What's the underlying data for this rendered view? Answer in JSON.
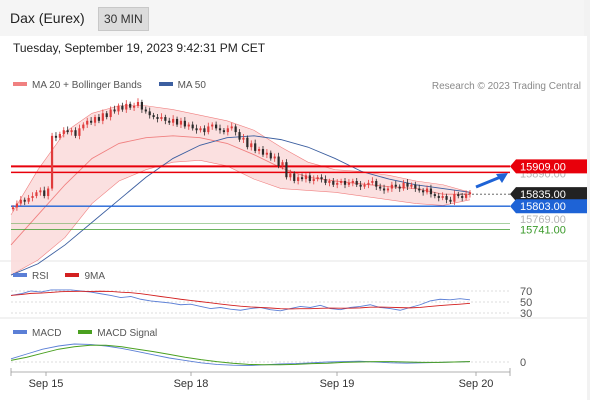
{
  "header": {
    "title": "Dax (Eurex)",
    "interval": "30 MIN"
  },
  "timestamp": "Tuesday, September 19, 2023 9:42:31 PM CET",
  "legend": {
    "bollinger": "MA 20 + Bollinger Bands",
    "ma50": "MA 50",
    "copyright": "Research © 2023 Trading Central"
  },
  "colors": {
    "bollinger": "#f08080",
    "band_fill": "#fadbdb",
    "ma50": "#3c5fa0",
    "resistance": "#e8000b",
    "pivot": "#1e63d6",
    "support": "#3a9a2a",
    "rsi": "#5b7fd6",
    "rsi_ma": "#d32020",
    "macd": "#5b7fd6",
    "macd_signal": "#4aa020",
    "up_candle": "#e03b3b",
    "down_candle": "#2a2a2a"
  },
  "chart_data": {
    "type": "candlestick",
    "instrument": "Dax (Eurex)",
    "interval": "30 MIN",
    "ylim": [
      15660,
      16080
    ],
    "x_ticks": [
      "Sep 15",
      "Sep 18",
      "Sep 19",
      "Sep 20"
    ],
    "price_levels": [
      {
        "value": 15909.0,
        "label": "15909.00",
        "kind": "resistance"
      },
      {
        "value": 15835.0,
        "label": "15835.00",
        "kind": "last"
      },
      {
        "value": 15803.0,
        "label": "15803.00",
        "kind": "pivot"
      },
      {
        "value": 15741.0,
        "label": "15741.00",
        "kind": "support"
      }
    ],
    "hidden_levels": [
      "15890.00",
      "15769.00"
    ],
    "candles_close": [
      15800,
      15810,
      15820,
      15815,
      15825,
      15830,
      15840,
      15845,
      15830,
      15850,
      15990,
      15985,
      15995,
      16005,
      16000,
      16005,
      15990,
      16010,
      16020,
      16030,
      16025,
      16040,
      16030,
      16050,
      16040,
      16060,
      16055,
      16070,
      16060,
      16075,
      16065,
      16070,
      16080,
      16060,
      16055,
      16045,
      16040,
      16035,
      16040,
      16030,
      16025,
      16035,
      16020,
      16030,
      16015,
      16020,
      16010,
      16005,
      16010,
      16000,
      16015,
      16020,
      16010,
      16005,
      16000,
      16010,
      16015,
      16000,
      15980,
      15985,
      15960,
      15970,
      15950,
      15955,
      15940,
      15945,
      15930,
      15935,
      15910,
      15920,
      15880,
      15890,
      15870,
      15880,
      15875,
      15885,
      15870,
      15875,
      15880,
      15875,
      15865,
      15870,
      15860,
      15865,
      15870,
      15860,
      15865,
      15870,
      15860,
      15855,
      15860,
      15865,
      15870,
      15855,
      15850,
      15845,
      15850,
      15860,
      15855,
      15850,
      15865,
      15855,
      15860,
      15850,
      15845,
      15840,
      15850,
      15835,
      15830,
      15825,
      15830,
      15820,
      15815,
      15835,
      15830,
      15825,
      15835,
      15840
    ],
    "ma20_mid": [
      15700,
      15780,
      15860,
      15930,
      15970,
      15985,
      15990,
      15985,
      15970,
      15940,
      15905,
      15880,
      15870,
      15862,
      15855,
      15850,
      15835,
      15835
    ],
    "ma20_upper": [
      15780,
      15900,
      16000,
      16050,
      16070,
      16070,
      16060,
      16045,
      16030,
      16005,
      15960,
      15920,
      15900,
      15895,
      15885,
      15870,
      15860,
      15840
    ],
    "ma20_lower": [
      15620,
      15660,
      15720,
      15810,
      15870,
      15900,
      15920,
      15925,
      15910,
      15875,
      15850,
      15845,
      15840,
      15830,
      15820,
      15810,
      15805,
      15820
    ],
    "ma50": [
      15620,
      15650,
      15700,
      15760,
      15820,
      15880,
      15930,
      15965,
      15985,
      15990,
      15980,
      15960,
      15930,
      15895,
      15875,
      15860,
      15850,
      15840
    ],
    "rsi": {
      "name": "RSI",
      "ma_name": "9MA",
      "levels": [
        70,
        50,
        30
      ],
      "values": [
        62,
        65,
        70,
        68,
        72,
        75,
        73,
        70,
        68,
        65,
        62,
        58,
        60,
        55,
        52,
        50,
        48,
        45,
        46,
        42,
        38,
        40,
        37,
        35,
        38,
        40,
        36,
        34,
        38,
        42,
        40,
        44,
        38,
        36,
        40,
        42,
        45,
        40,
        38,
        35,
        40,
        45,
        52,
        55,
        54,
        56,
        54
      ]
    },
    "macd": {
      "name": "MACD",
      "signal_name": "MACD Signal",
      "zero_label": "0",
      "macd": [
        8,
        20,
        32,
        40,
        45,
        44,
        40,
        34,
        26,
        18,
        10,
        4,
        -2,
        -6,
        -8,
        -9,
        -7,
        -5,
        -4,
        -2,
        0,
        1,
        2,
        0,
        -2,
        -3,
        -2,
        -1,
        0,
        1
      ],
      "signal": [
        4,
        12,
        22,
        32,
        38,
        42,
        42,
        38,
        32,
        26,
        19,
        12,
        6,
        1,
        -3,
        -6,
        -7,
        -7,
        -6,
        -4,
        -3,
        -1,
        0,
        1,
        1,
        0,
        -1,
        -1,
        0,
        1
      ]
    }
  }
}
